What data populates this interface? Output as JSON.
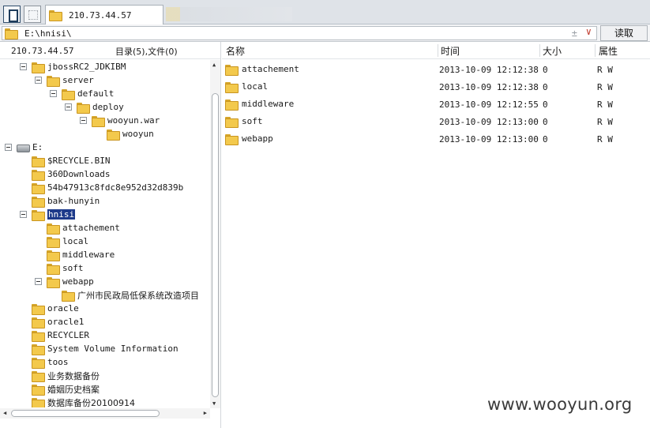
{
  "tabbar": {
    "tab_title": "210.73.44.57"
  },
  "address": {
    "path": "E:\\hnisi\\",
    "read_button": "读取"
  },
  "left_pane": {
    "host": "210.73.44.57",
    "count_label": "目录(5),文件(0)",
    "tree": [
      {
        "label": "jbossRC2_JDKIBM",
        "expanded": true
      },
      {
        "label": "server",
        "expanded": true
      },
      {
        "label": "default",
        "expanded": true
      },
      {
        "label": "deploy",
        "expanded": true
      },
      {
        "label": "wooyun.war",
        "expanded": true
      },
      {
        "label": "wooyun",
        "expanded": false
      },
      {
        "label": "E:",
        "expanded": true
      },
      {
        "label": "$RECYCLE.BIN"
      },
      {
        "label": "360Downloads"
      },
      {
        "label": "54b47913c8fdc8e952d32d839b"
      },
      {
        "label": "bak-hunyin"
      },
      {
        "label": "hnisi",
        "expanded": true,
        "selected": true
      },
      {
        "label": "attachement"
      },
      {
        "label": "local"
      },
      {
        "label": "middleware"
      },
      {
        "label": "soft"
      },
      {
        "label": "webapp",
        "expanded": true
      },
      {
        "label": "广州市民政局低保系统改造项目"
      },
      {
        "label": "oracle"
      },
      {
        "label": "oracle1"
      },
      {
        "label": "RECYCLER"
      },
      {
        "label": "System Volume Information"
      },
      {
        "label": "toos"
      },
      {
        "label": "业务数据备份"
      },
      {
        "label": "婚姻历史档案"
      },
      {
        "label": "数据库备份20100914"
      }
    ]
  },
  "file_list": {
    "columns": {
      "name": "名称",
      "time": "时间",
      "size": "大小",
      "attr": "属性"
    },
    "rows": [
      {
        "name": "attachement",
        "time": "2013-10-09 12:12:38",
        "size": "0",
        "attr": "R W"
      },
      {
        "name": "local",
        "time": "2013-10-09 12:12:38",
        "size": "0",
        "attr": "R W"
      },
      {
        "name": "middleware",
        "time": "2013-10-09 12:12:55",
        "size": "0",
        "attr": "R W"
      },
      {
        "name": "soft",
        "time": "2013-10-09 12:13:00",
        "size": "0",
        "attr": "R W"
      },
      {
        "name": "webapp",
        "time": "2013-10-09 12:13:00",
        "size": "0",
        "attr": "R W"
      }
    ]
  },
  "watermark": "www.wooyun.org",
  "colors": {
    "selection": "#1d3a8a",
    "folder": "#f3c94c",
    "chevron": "#c0392b"
  }
}
